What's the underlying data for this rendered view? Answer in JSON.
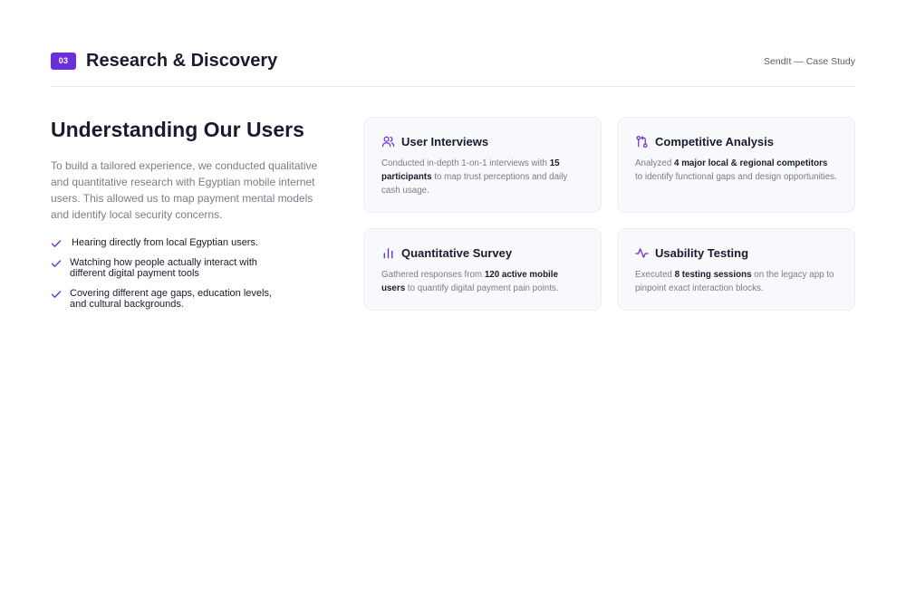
{
  "header": {
    "badge": "03",
    "title": "Research & Discovery",
    "meta": "SendIt — Case Study"
  },
  "section": {
    "title": "Understanding Our Users",
    "intro": "To build a tailored experience, we conducted qualitative and quantitative research with Egyptian mobile internet users. This allowed us to map payment mental models and identify local security concerns.",
    "checklist": [
      "Hearing directly from local Egyptian users.",
      "Watching how people actually interact with different digital payment tools",
      "Covering different age gaps, education levels, and cultural backgrounds."
    ]
  },
  "cards": [
    {
      "title": "User Interviews",
      "icon": "users-icon",
      "pre": "Conducted in-depth 1-on-1 interviews with ",
      "bold": "15 participants",
      "post": " to map trust perceptions and daily cash usage."
    },
    {
      "title": "Competitive Analysis",
      "icon": "compare-icon",
      "pre": "Analyzed ",
      "bold": "4 major local & regional competitors",
      "post": " to identify functional gaps and design opportunities."
    },
    {
      "title": "Quantitative Survey",
      "icon": "bar-chart-icon",
      "pre": "Gathered responses from ",
      "bold": "120 active mobile users",
      "post": " to quantify digital payment pain points."
    },
    {
      "title": "Usability Testing",
      "icon": "activity-icon",
      "pre": "Executed ",
      "bold": "8 testing sessions",
      "post": " on the legacy app to pinpoint exact interaction blocks."
    }
  ],
  "colors": {
    "accent": "#6b2fd9",
    "text": "#1a1b2e",
    "muted": "#7a7c8a",
    "card_bg": "#f8f9fc"
  }
}
